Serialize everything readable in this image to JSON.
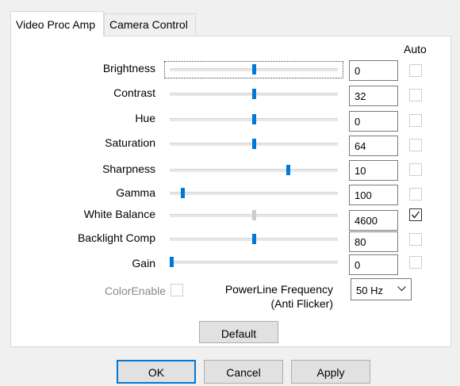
{
  "tabs": [
    {
      "label": "Video Proc Amp",
      "active": true
    },
    {
      "label": "Camera Control",
      "active": false
    }
  ],
  "auto_header": "Auto",
  "properties": [
    {
      "label": "Brightness",
      "value": "0",
      "level": 0.5,
      "auto": false
    },
    {
      "label": "Contrast",
      "value": "32",
      "level": 0.5,
      "auto": false
    },
    {
      "label": "Hue",
      "value": "0",
      "level": 0.5,
      "auto": false
    },
    {
      "label": "Saturation",
      "value": "64",
      "level": 0.5,
      "auto": false
    },
    {
      "label": "Sharpness",
      "value": "10",
      "level": 0.71,
      "auto": false
    },
    {
      "label": "Gamma",
      "value": "100",
      "level": 0.07,
      "auto": false
    },
    {
      "label": "White Balance",
      "value": "4600",
      "level": 0.5,
      "auto": true
    },
    {
      "label": "Backlight Comp",
      "value": "80",
      "level": 0.5,
      "auto": false
    },
    {
      "label": "Gain",
      "value": "0",
      "level": 0.0,
      "auto": false
    }
  ],
  "color_enable": {
    "label": "ColorEnable",
    "checked": false
  },
  "powerline": {
    "label_line1": "PowerLine Frequency",
    "label_line2": "(Anti Flicker)",
    "selected": "50 Hz"
  },
  "buttons": {
    "default": "Default",
    "ok": "OK",
    "cancel": "Cancel",
    "apply": "Apply"
  },
  "colors": {
    "accent": "#0078d7",
    "panel": "#ffffff",
    "window": "#f0f0f0"
  }
}
